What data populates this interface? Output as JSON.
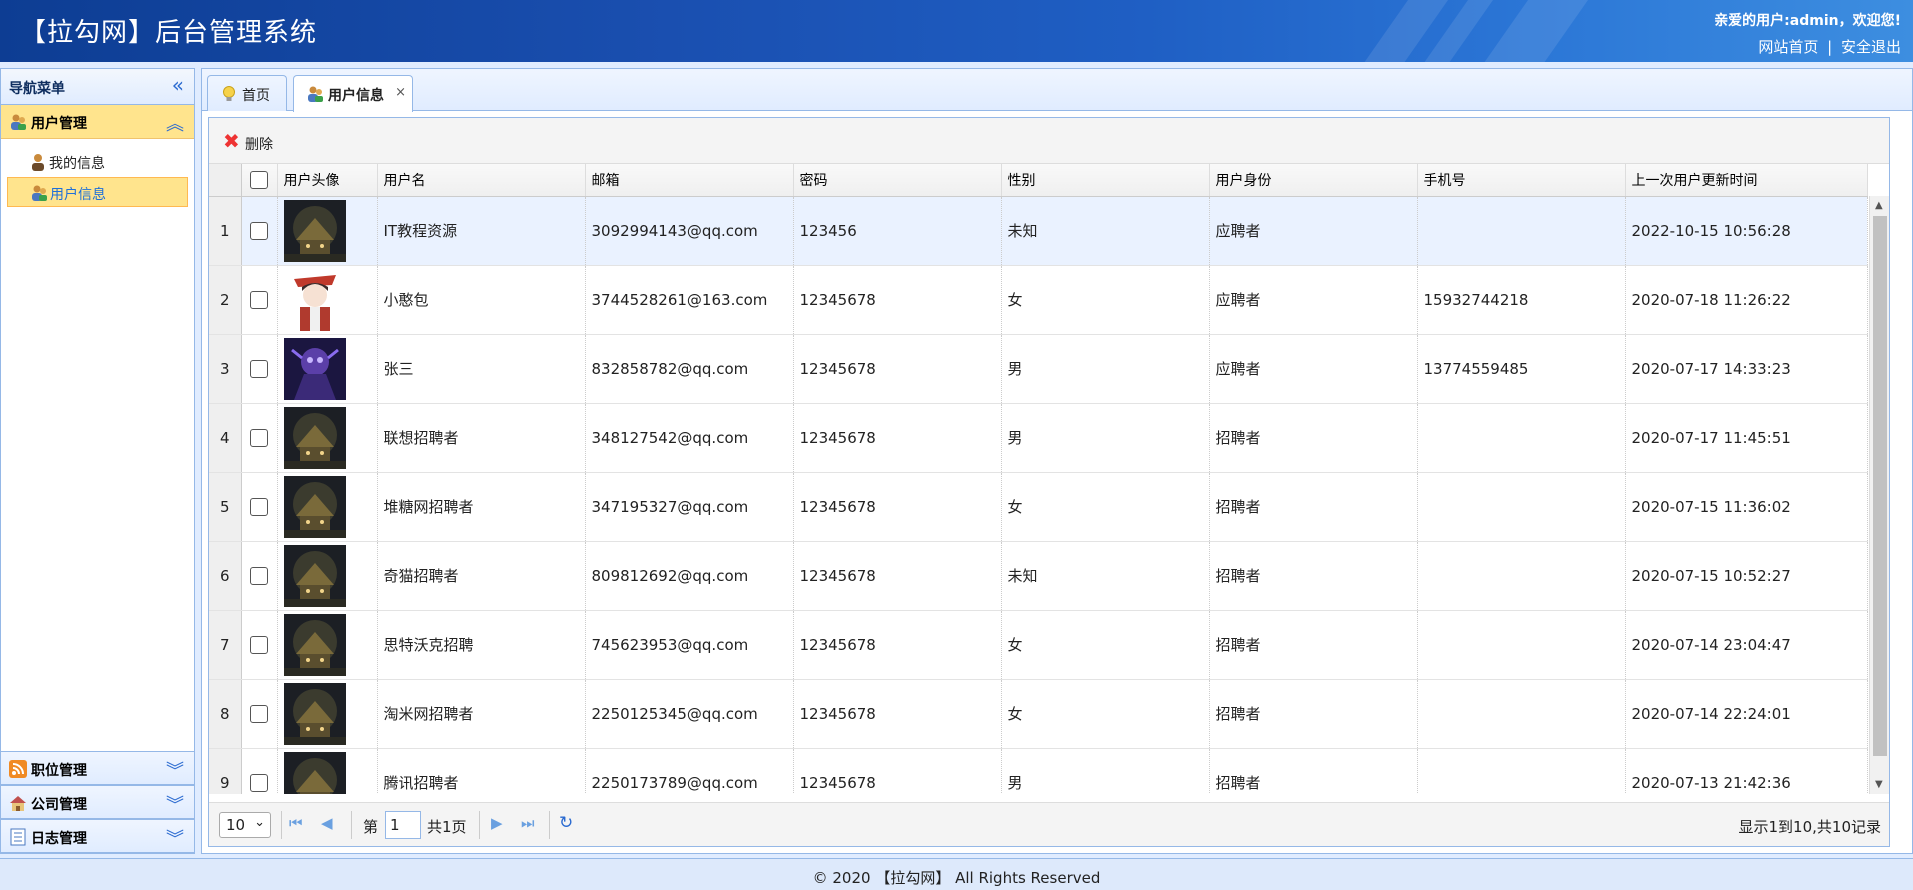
{
  "header": {
    "title": "【拉勾网】后台管理系统",
    "welcome": "亲爱的用户:admin，欢迎您!",
    "home_link": "网站首页",
    "separator": "|",
    "logout_link": "安全退出"
  },
  "sidebar": {
    "title": "导航菜单",
    "active_panel": "用户管理",
    "items": [
      {
        "label": "我的信息",
        "icon": "user-icon"
      },
      {
        "label": "用户信息",
        "icon": "users-icon"
      }
    ],
    "collapsed_panels": [
      "职位管理",
      "公司管理",
      "日志管理"
    ]
  },
  "tabs": [
    {
      "label": "首页",
      "icon": "lightbulb-icon"
    },
    {
      "label": "用户信息",
      "icon": "users-icon",
      "close": "×"
    }
  ],
  "toolbar": {
    "delete_label": "删除"
  },
  "table": {
    "headers": [
      "用户头像",
      "用户名",
      "邮箱",
      "密码",
      "性别",
      "用户身份",
      "手机号",
      "上一次用户更新时间"
    ],
    "rows": [
      {
        "n": "1",
        "username": "IT教程资源",
        "email": "3092994143@qq.com",
        "password": "123456",
        "gender": "未知",
        "role": "应聘者",
        "phone": "",
        "updated": "2022-10-15 10:56:28",
        "avatar": "dark-house"
      },
      {
        "n": "2",
        "username": "小憨包",
        "email": "3744528261@163.com",
        "password": "12345678",
        "gender": "女",
        "role": "应聘者",
        "phone": "15932744218",
        "updated": "2020-07-18 11:26:22",
        "avatar": "anime-girl"
      },
      {
        "n": "3",
        "username": "张三",
        "email": "832858782@qq.com",
        "password": "12345678",
        "gender": "男",
        "role": "应聘者",
        "phone": "13774559485",
        "updated": "2020-07-17 14:33:23",
        "avatar": "purple-hero"
      },
      {
        "n": "4",
        "username": "联想招聘者",
        "email": "348127542@qq.com",
        "password": "12345678",
        "gender": "男",
        "role": "招聘者",
        "phone": "",
        "updated": "2020-07-17 11:45:51",
        "avatar": "dark-house"
      },
      {
        "n": "5",
        "username": "堆糖网招聘者",
        "email": "347195327@qq.com",
        "password": "12345678",
        "gender": "女",
        "role": "招聘者",
        "phone": "",
        "updated": "2020-07-15 11:36:02",
        "avatar": "dark-house"
      },
      {
        "n": "6",
        "username": "奇猫招聘者",
        "email": "809812692@qq.com",
        "password": "12345678",
        "gender": "未知",
        "role": "招聘者",
        "phone": "",
        "updated": "2020-07-15 10:52:27",
        "avatar": "dark-house"
      },
      {
        "n": "7",
        "username": "思特沃克招聘",
        "email": "745623953@qq.com",
        "password": "12345678",
        "gender": "女",
        "role": "招聘者",
        "phone": "",
        "updated": "2020-07-14 23:04:47",
        "avatar": "dark-house"
      },
      {
        "n": "8",
        "username": "淘米网招聘者",
        "email": "2250125345@qq.com",
        "password": "12345678",
        "gender": "女",
        "role": "招聘者",
        "phone": "",
        "updated": "2020-07-14 22:24:01",
        "avatar": "dark-house"
      },
      {
        "n": "9",
        "username": "腾讯招聘者",
        "email": "2250173789@qq.com",
        "password": "12345678",
        "gender": "男",
        "role": "招聘者",
        "phone": "",
        "updated": "2020-07-13 21:42:36",
        "avatar": "dark-house"
      }
    ]
  },
  "pager": {
    "page_size": "10",
    "page_prefix": "第",
    "current_page": "1",
    "page_total": "共1页",
    "info": "显示1到10,共10记录"
  },
  "footer": {
    "text": "© 2020 【拉勾网】 All Rights Reserved"
  },
  "colors": {
    "accent": "#95b8e7",
    "highlight": "#ffe48d",
    "header_start": "#0d3d93",
    "header_end": "#3d8ee0"
  }
}
